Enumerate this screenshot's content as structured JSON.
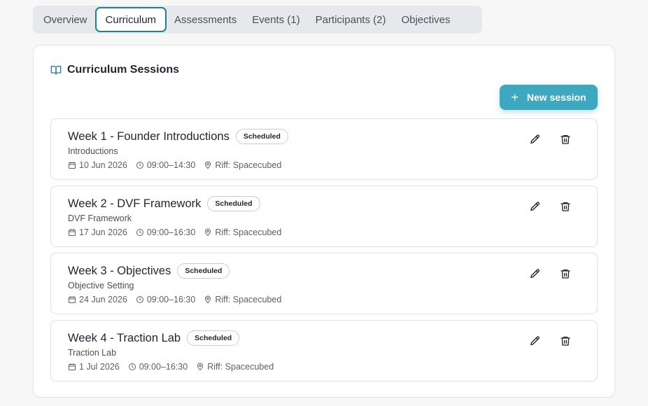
{
  "tabs": [
    {
      "label": "Overview",
      "active": false
    },
    {
      "label": "Curriculum",
      "active": true
    },
    {
      "label": "Assessments",
      "active": false
    },
    {
      "label": "Events (1)",
      "active": false
    },
    {
      "label": "Participants (2)",
      "active": false
    },
    {
      "label": "Objectives",
      "active": false
    }
  ],
  "card": {
    "title": "Curriculum Sessions",
    "icon": "book-open-icon",
    "new_button_label": "New session"
  },
  "sessions": [
    {
      "title": "Week 1 - Founder Introductions",
      "status": "Scheduled",
      "description": "Introductions",
      "date": "10 Jun 2026",
      "time": "09:00–14:30",
      "location": "Riff: Spacecubed"
    },
    {
      "title": "Week 2 - DVF Framework",
      "status": "Scheduled",
      "description": "DVF Framework",
      "date": "17 Jun 2026",
      "time": "09:00–16:30",
      "location": "Riff: Spacecubed"
    },
    {
      "title": "Week 3 - Objectives",
      "status": "Scheduled",
      "description": "Objective Setting",
      "date": "24 Jun 2026",
      "time": "09:00–16:30",
      "location": "Riff: Spacecubed"
    },
    {
      "title": "Week 4 - Traction Lab",
      "status": "Scheduled",
      "description": "Traction Lab",
      "date": "1 Jul 2026",
      "time": "09:00–16:30",
      "location": "Riff: Spacecubed"
    }
  ],
  "colors": {
    "accent": "#1f7f93",
    "button": "#3fa8c1"
  }
}
